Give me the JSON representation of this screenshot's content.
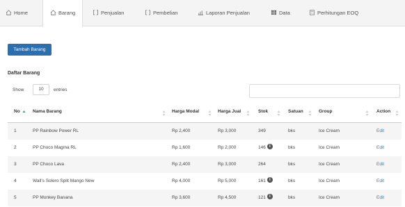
{
  "tabs": [
    {
      "label": "Home",
      "icon": "home-icon"
    },
    {
      "label": "Barang",
      "icon": "home-icon"
    },
    {
      "label": "Penjualan",
      "icon": "bracket-icon"
    },
    {
      "label": "Pembelian",
      "icon": "bracket-icon"
    },
    {
      "label": "Laporan Penjualan",
      "icon": "report-icon"
    },
    {
      "label": "Data",
      "icon": "table-icon"
    },
    {
      "label": "Perhitungan EOQ",
      "icon": "calculator-icon"
    }
  ],
  "active_tab": "Barang",
  "add_button_label": "Tambah Barang",
  "list_title": "Daftar Barang",
  "length": {
    "show_label": "Show",
    "value": "10",
    "entries_label": "entries"
  },
  "search": {
    "value": ""
  },
  "table": {
    "headers": {
      "no": "No",
      "name": "Nama Barang",
      "cost": "Harga Modal",
      "price": "Harga Jual",
      "stock": "Stok",
      "unit": "Satuan",
      "group": "Group",
      "action": "Action"
    },
    "sorted_column": "No",
    "sort_direction": "ascending",
    "rows": [
      {
        "no": "1",
        "name": "PP Rainbow Power RL",
        "cost": "Rp 2,400",
        "price": "Rp 3,000",
        "stock": "349",
        "stock_alert": false,
        "unit": "bks",
        "group": "Ice Cream",
        "action": "Edit"
      },
      {
        "no": "2",
        "name": "PP Choco Magma RL",
        "cost": "Rp 1,600",
        "price": "Rp 2,000",
        "stock": "146",
        "stock_alert": true,
        "unit": "bks",
        "group": "Ice Cream",
        "action": "Edit"
      },
      {
        "no": "3",
        "name": "PP Choco Lava",
        "cost": "Rp 2,400",
        "price": "Rp 3,000",
        "stock": "264",
        "stock_alert": false,
        "unit": "bks",
        "group": "Ice Cream",
        "action": "Edit"
      },
      {
        "no": "4",
        "name": "Wall's Solero Split Mango New",
        "cost": "Rp 4,000",
        "price": "Rp 5,000",
        "stock": "161",
        "stock_alert": true,
        "unit": "bks",
        "group": "Ice Cream",
        "action": "Edit"
      },
      {
        "no": "5",
        "name": "PP Monkey Banana",
        "cost": "Rp 3,600",
        "price": "Rp 4,500",
        "stock": "121",
        "stock_alert": true,
        "unit": "bks",
        "group": "Ice Cream",
        "action": "Edit"
      }
    ]
  },
  "colors": {
    "primary_button": "#2c6fb1",
    "edit_link": "#2f80d0",
    "sort_active": "#18a8a0",
    "stock_alert_badge": "#555555"
  }
}
